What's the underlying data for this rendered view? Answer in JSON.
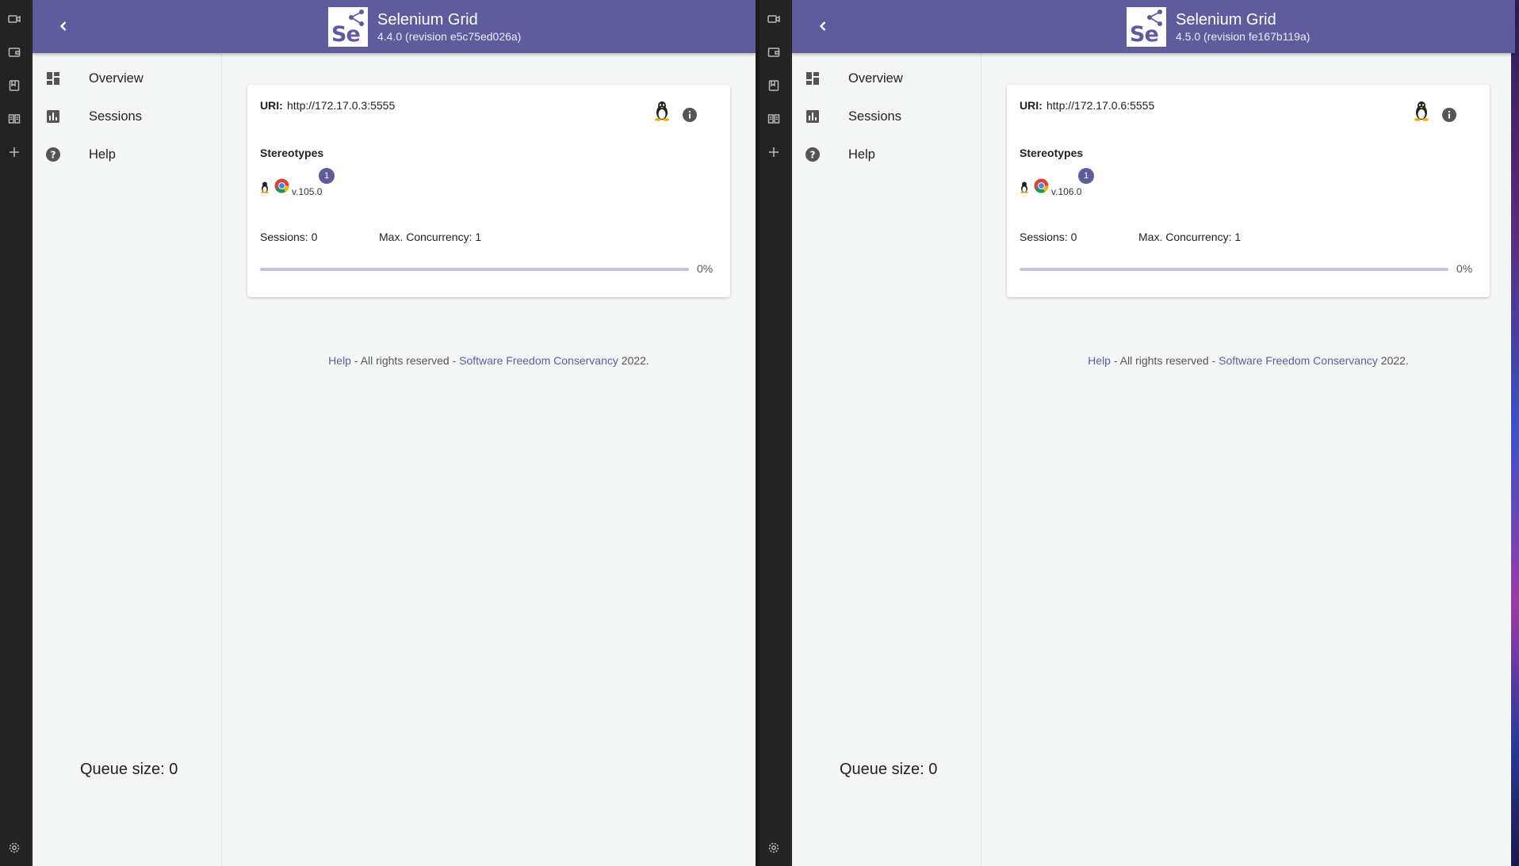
{
  "windows": [
    {
      "header": {
        "title": "Selenium Grid",
        "subtitle": "4.4.0 (revision e5c75ed026a)",
        "logo_text": "Se"
      },
      "nav": [
        {
          "label": "Overview",
          "icon": "dashboard-icon"
        },
        {
          "label": "Sessions",
          "icon": "assessment-icon"
        },
        {
          "label": "Help",
          "icon": "help-icon"
        }
      ],
      "queue": "Queue size: 0",
      "node": {
        "uri_label": "URI:",
        "uri": "http://172.17.0.3:5555",
        "stereotypes_label": "Stereotypes",
        "browser_version": "v.105.0",
        "slot_count": "1",
        "sessions": "Sessions: 0",
        "max_concurrency": "Max. Concurrency: 1",
        "load_percent": "0%",
        "load_fraction": 0
      },
      "footer": {
        "help": "Help",
        "mid": " - All rights reserved - ",
        "org": "Software Freedom Conservancy",
        "year": " 2022."
      }
    },
    {
      "header": {
        "title": "Selenium Grid",
        "subtitle": "4.5.0 (revision fe167b119a)",
        "logo_text": "Se"
      },
      "nav": [
        {
          "label": "Overview",
          "icon": "dashboard-icon"
        },
        {
          "label": "Sessions",
          "icon": "assessment-icon"
        },
        {
          "label": "Help",
          "icon": "help-icon"
        }
      ],
      "queue": "Queue size: 0",
      "node": {
        "uri_label": "URI:",
        "uri": "http://172.17.0.6:5555",
        "stereotypes_label": "Stereotypes",
        "browser_version": "v.106.0",
        "slot_count": "1",
        "sessions": "Sessions: 0",
        "max_concurrency": "Max. Concurrency: 1",
        "load_percent": "0%",
        "load_fraction": 0
      },
      "footer": {
        "help": "Help",
        "mid": " - All rights reserved - ",
        "org": "Software Freedom Conservancy",
        "year": " 2022."
      }
    }
  ],
  "colors": {
    "brand": "#5f5c9e",
    "background": "#f4f6f6",
    "rail": "#232323"
  },
  "rail_icons": [
    "video-icon",
    "wallet-icon",
    "bookmark-icon",
    "reader-icon",
    "plus-icon",
    "settings-icon"
  ]
}
